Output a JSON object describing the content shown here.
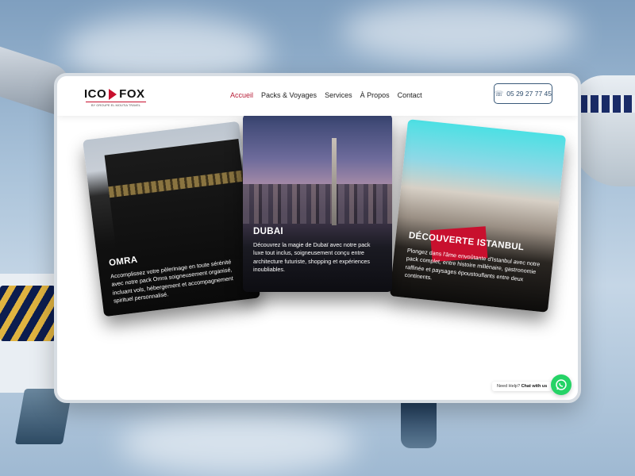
{
  "header": {
    "logo": {
      "left": "ICO",
      "right": "FOX",
      "tagline": "BY GROUPE EL MOUTIA TRAVEL"
    },
    "nav": [
      {
        "label": "Accueil",
        "active": true
      },
      {
        "label": "Packs & Voyages",
        "active": false
      },
      {
        "label": "Services",
        "active": false
      },
      {
        "label": "À Propos",
        "active": false
      },
      {
        "label": "Contact",
        "active": false
      }
    ],
    "phone": "05 29 27 77 45"
  },
  "cards": [
    {
      "title": "OMRA",
      "description": "Accomplissez votre pèlerinage en toute sérénité avec notre pack Omra soigneusement organisé, incluant vols, hébergement et accompagnement spirituel personnalisé."
    },
    {
      "title": "DUBAI",
      "description": "Découvrez la magie de Dubaï avec notre pack luxe tout inclus, soigneusement conçu entre architecture futuriste, shopping et expériences inoubliables."
    },
    {
      "title": "DÉCOUVERTE ISTANBUL",
      "description": "Plongez dans l'âme envoûtante d'Istanbul avec notre pack complet, entre histoire millénaire, gastronomie raffinée et paysages époustouflants entre deux continents."
    }
  ],
  "whatsapp": {
    "prefix": "Need Help?",
    "cta": "Chat with us"
  },
  "colors": {
    "accent": "#b8203a",
    "whatsapp": "#25d366",
    "phone_border": "#3a5a7a"
  }
}
